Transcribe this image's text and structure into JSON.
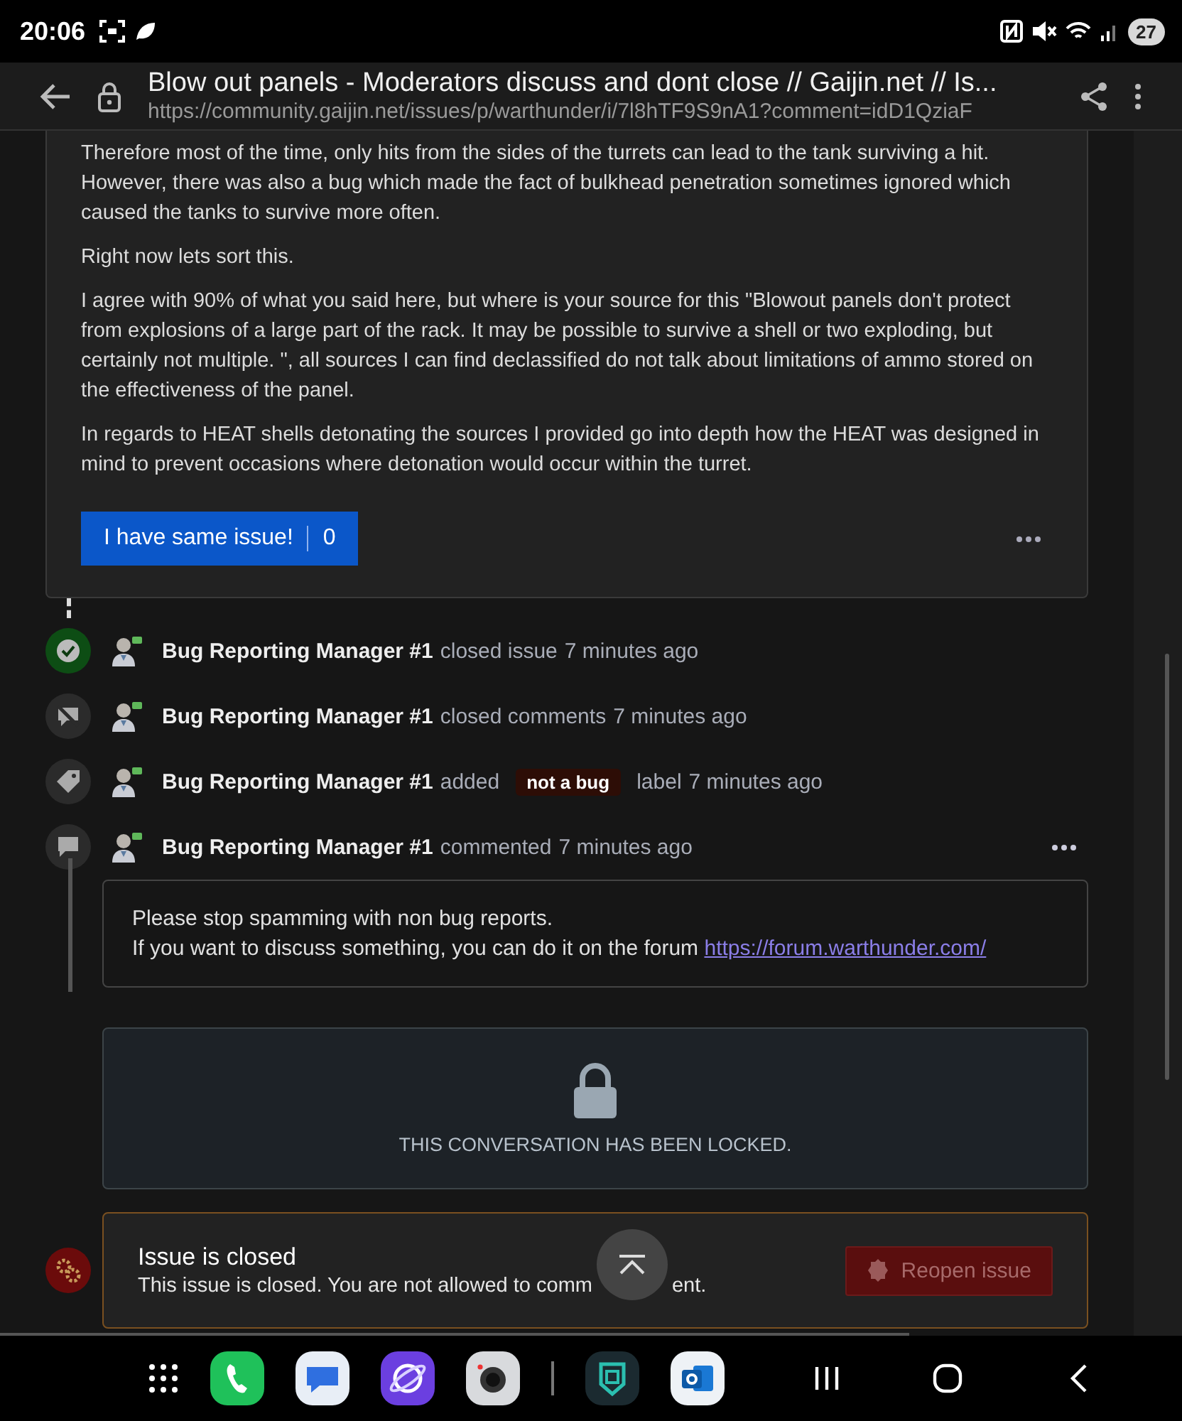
{
  "status_bar": {
    "time": "20:06",
    "battery": "27"
  },
  "browser": {
    "title": "Blow out panels - Moderators discuss and dont close // Gaijin.net // Is...",
    "url": "https://community.gaijin.net/issues/p/warthunder/i/7l8hTF9S9nA1?comment=idD1QziaF"
  },
  "post": {
    "paragraphs": [
      "Therefore most of the time, only hits from the sides of the turrets can lead to the tank surviving a hit. However, there was also a bug which made the fact of bulkhead penetration sometimes ignored which caused the tanks to survive more often.",
      "Right now lets sort this.",
      "I agree with 90% of what you said here, but where is your source for this \"Blowout panels don't protect from explosions of a large part of the rack. It may be possible to survive a shell or two exploding, but certainly not multiple. \", all sources I can find declassified do not talk about limitations of ammo stored on the effectiveness of the panel.",
      "In regards to HEAT shells detonating the sources I provided go into depth how the HEAT was designed in mind to prevent occasions where detonation would occur within the turret."
    ],
    "same_issue_button": {
      "label": "I have same issue!",
      "count": "0"
    }
  },
  "timeline": [
    {
      "kind": "closed",
      "author": "Bug Reporting Manager #1",
      "action": "closed issue",
      "time": "7 minutes ago"
    },
    {
      "kind": "comments_closed",
      "author": "Bug Reporting Manager #1",
      "action": "closed comments",
      "time": "7 minutes ago"
    },
    {
      "kind": "label",
      "author": "Bug Reporting Manager #1",
      "action": "added",
      "label": "not a bug",
      "after": "label",
      "time": "7 minutes ago"
    },
    {
      "kind": "comment",
      "author": "Bug Reporting Manager #1",
      "action": "commented",
      "time": "7 minutes ago",
      "comment": {
        "lines": [
          "Please stop spamming with non bug reports.",
          "If you want to discuss something, you can do it on the forum"
        ],
        "link": "https://forum.warthunder.com/"
      }
    }
  ],
  "locked_notice": "THIS CONVERSATION HAS BEEN LOCKED.",
  "closed_notice": {
    "title": "Issue is closed",
    "text_before": "This issue is closed. You are not allowed to comm",
    "text_after": "ent.",
    "button": "Reopen issue"
  }
}
